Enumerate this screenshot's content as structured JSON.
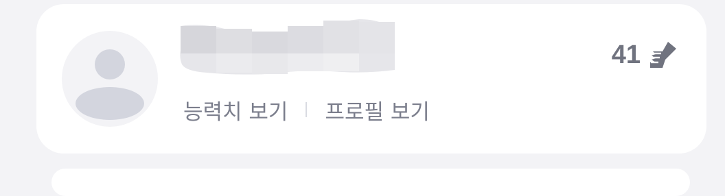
{
  "card": {
    "name_redacted": true,
    "avatar_icon": "default-user-avatar-icon",
    "links": {
      "ability_label": "능력치 보기",
      "profile_label": "프로필 보기"
    },
    "likes": {
      "count": "41",
      "icon": "thumbs-up-icon"
    }
  },
  "colors": {
    "background": "#f3f3f6",
    "card": "#ffffff",
    "avatar_bg": "#f3f3f6",
    "avatar_fg": "#d3d5de",
    "link_text": "#7b7e8c",
    "likes_text": "#70737f"
  }
}
